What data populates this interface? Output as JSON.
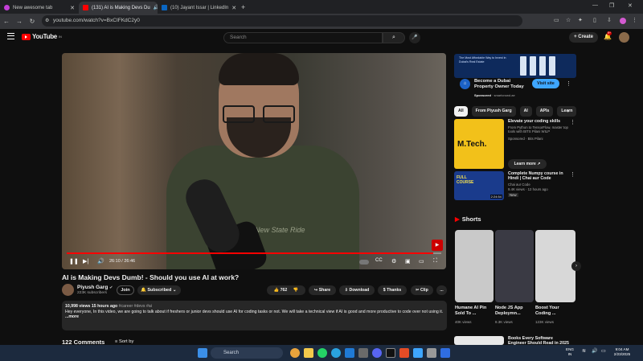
{
  "browser": {
    "tabs": [
      {
        "title": "New awesome tab",
        "favicon_color": "#c43fd8"
      },
      {
        "title": "(131) AI is Making Devs Du",
        "favicon_color": "#ff0000"
      },
      {
        "title": "(10) Jayant Issar | LinkedIn",
        "favicon_color": "#0a66c2"
      }
    ],
    "url": "youtube.com/watch?v=BxCIFKdC2y0"
  },
  "youtube": {
    "logo": "YouTube",
    "logo_region": "IN",
    "search_placeholder": "Search",
    "create_label": "Create",
    "notifications": "9+"
  },
  "player": {
    "time": "26:10 / 26:46",
    "progress": 0.978,
    "hoodie_text": "New State Ride"
  },
  "video": {
    "title": "AI is Making Devs Dumb! - Should you use AI at work?",
    "channel": "Piyush Garg",
    "verified": "✔",
    "subscribers": "223K subscribers",
    "join": "Join",
    "subscribed": "Subscribed",
    "likes": "762",
    "share": "Share",
    "download": "Download",
    "thanks": "Thanks",
    "clip": "Clip",
    "more": "...",
    "stats": "10,998 views  15 hours ago",
    "tags": "#career #devs #ai",
    "description": "Hey everyone, In this video, we are going to talk about if freshers or junior devs should use AI for coding tasks or not. We will take a technical view if AI is good and more productive to code over not using it.",
    "more_link": "...more",
    "comments": "122 Comments",
    "sort_by": "Sort by"
  },
  "ad": {
    "banner_text": "The Most Affordable Way to Invest in Dubai's Real Estate",
    "title": "Become a Dubai Property Owner Today",
    "sponsored": "Sponsored",
    "domain": "smartcrowd.ae",
    "visit": "Visit site"
  },
  "chips": [
    "All",
    "From Piyush Garg",
    "AI",
    "APIs",
    "Learn"
  ],
  "recs": [
    {
      "title": "Elevate your coding skills",
      "meta": "From Python to TensorFlow, master top tools with BITS Pilani WILP",
      "channel": "Sponsored · Bits Pilani",
      "thumb_text": "M.Tech.",
      "learn": "Learn more"
    },
    {
      "title": "Complete Numpy course in Hindi | Chai aur Code",
      "channel": "Chai aur Code",
      "meta": "9.4K views · 12 hours ago",
      "badge": "New",
      "thumb_text": "FULL COURSE",
      "duration": "2:24:54"
    },
    {
      "title": "Books Every Software Engineer Should Read in 2025"
    }
  ],
  "shorts": {
    "heading": "Shorts",
    "items": [
      {
        "title": "Humane AI Pin Sold To ...",
        "views": "40K views",
        "bg": "#c9c9c9"
      },
      {
        "title": "Node JS App Deploymn...",
        "views": "8.3K views",
        "bg": "#3a3a44"
      },
      {
        "title": "Boost Your Coding ...",
        "views": "123K views",
        "bg": "#d8d8d8"
      }
    ]
  },
  "taskbar": {
    "search": "Search",
    "lang": "ENG\nIN",
    "time": "9:04 AM",
    "date": "2/23/2025"
  }
}
